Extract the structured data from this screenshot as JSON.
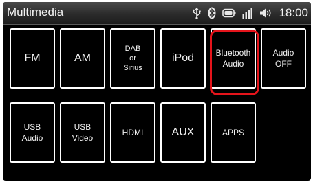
{
  "status_bar": {
    "title": "Multimedia",
    "icons": [
      "usb-icon",
      "bluetooth-icon",
      "battery-icon",
      "signal-icon",
      "volume-icon"
    ],
    "time": "18:00"
  },
  "tiles": [
    {
      "label": "FM"
    },
    {
      "label": "AM"
    },
    {
      "label": "DAB\nor\nSirius"
    },
    {
      "label": "iPod"
    },
    {
      "label": "Bluetooth\nAudio"
    },
    {
      "label": "Audio\nOFF"
    },
    {
      "label": "USB\nAudio"
    },
    {
      "label": "USB\nVideo"
    },
    {
      "label": "HDMI"
    },
    {
      "label": "AUX"
    },
    {
      "label": "APPS"
    }
  ],
  "highlight": {
    "tile": "Bluetooth Audio",
    "color": "#e5141b"
  },
  "colors": {
    "background": "#000000",
    "tile_border": "#ffffff",
    "text": "#f2f2f2"
  }
}
